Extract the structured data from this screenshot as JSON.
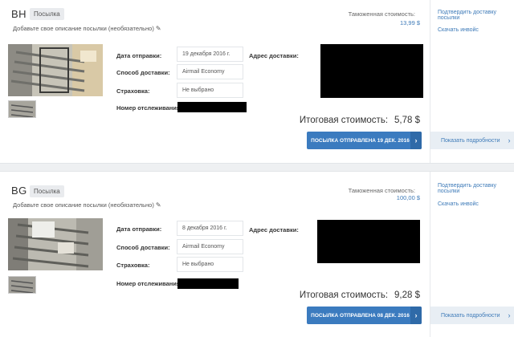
{
  "parcels": [
    {
      "code": "BH",
      "tag": "Посылка",
      "description": "Добавьте свое описание посылки (необязательно)",
      "customs_label": "Таможенная стоимость:",
      "customs_value": "13,99 $",
      "fields": {
        "ship_date_label": "Дата отправки:",
        "ship_date": "19 декабря 2016 г.",
        "method_label": "Способ доставки:",
        "method": "Airmail Economy",
        "insurance_label": "Страховка:",
        "insurance": "Не выбрано",
        "tracking_label": "Номер отслеживания:"
      },
      "address_label": "Адрес доставки:",
      "total_label": "Итоговая стоимость:",
      "total_value": "5,78 $",
      "status_button": "ПОСЫЛКА ОТПРАВЛЕНА 19 ДЕК. 2016",
      "side_links": [
        "Подтвердить доставку посылки",
        "Скачать инвойс"
      ],
      "details_label": "Показать подробности"
    },
    {
      "code": "BG",
      "tag": "Посылка",
      "description": "Добавьте свое описание посылки (необязательно)",
      "customs_label": "Таможенная стоимость:",
      "customs_value": "100,00 $",
      "fields": {
        "ship_date_label": "Дата отправки:",
        "ship_date": "8 декабря 2016 г.",
        "method_label": "Способ доставки:",
        "method": "Airmail Economy",
        "insurance_label": "Страховка:",
        "insurance": "Не выбрано",
        "tracking_label": "Номер отслеживания:"
      },
      "address_label": "Адрес доставки:",
      "total_label": "Итоговая стоимость:",
      "total_value": "9,28 $",
      "status_button": "ПОСЫЛКА ОТПРАВЛЕНА 08 ДЕК. 2016",
      "side_links": [
        "Подтвердить доставку посылки",
        "Скачать инвойс"
      ],
      "details_label": "Показать подробности"
    }
  ],
  "icons": {
    "pencil": "pencil-icon",
    "arrow": "chevron-right-icon"
  },
  "colors": {
    "accent": "#3b7bbf",
    "link": "#3d7ab8",
    "redaction": "#000000"
  }
}
